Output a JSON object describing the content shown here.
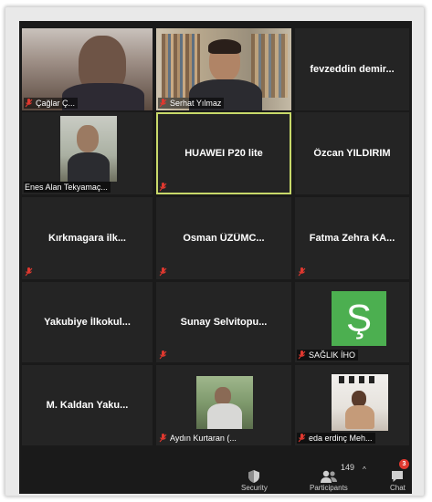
{
  "colors": {
    "background": "#1a1a1a",
    "tile": "#242424",
    "active_border": "#c8d96a",
    "muted_mic": "#e0382f",
    "avatar_green": "#4caf50"
  },
  "participants": [
    {
      "label": "Çağlar Ç..."
    },
    {
      "label": "Serhat Yılmaz"
    },
    {
      "name": "fevzeddin  demir..."
    },
    {
      "label": "Enes Alan Tekyamaç..."
    },
    {
      "name": "HUAWEI P20 lite"
    },
    {
      "name": "Özcan YILDIRIM"
    },
    {
      "name": "Kırkmagara  ilk..."
    },
    {
      "name": "Osman  ÜZÜMC..."
    },
    {
      "name": "Fatma Zehra KA..."
    },
    {
      "name": "Yakubiye  İlkokul..."
    },
    {
      "name": "Sunay  Selvitopu..."
    },
    {
      "label": "SAĞLIK İHO",
      "avatar_letter": "Ş"
    },
    {
      "name": "M.  Kaldan  Yaku..."
    },
    {
      "label": "Aydın Kurtaran (..."
    },
    {
      "label": "eda erdinç Meh..."
    }
  ],
  "toolbar": {
    "security_label": "Security",
    "participants_label": "Participants",
    "participants_count": "149",
    "chat_label": "Chat",
    "chat_badge": "3",
    "caret": "^"
  }
}
